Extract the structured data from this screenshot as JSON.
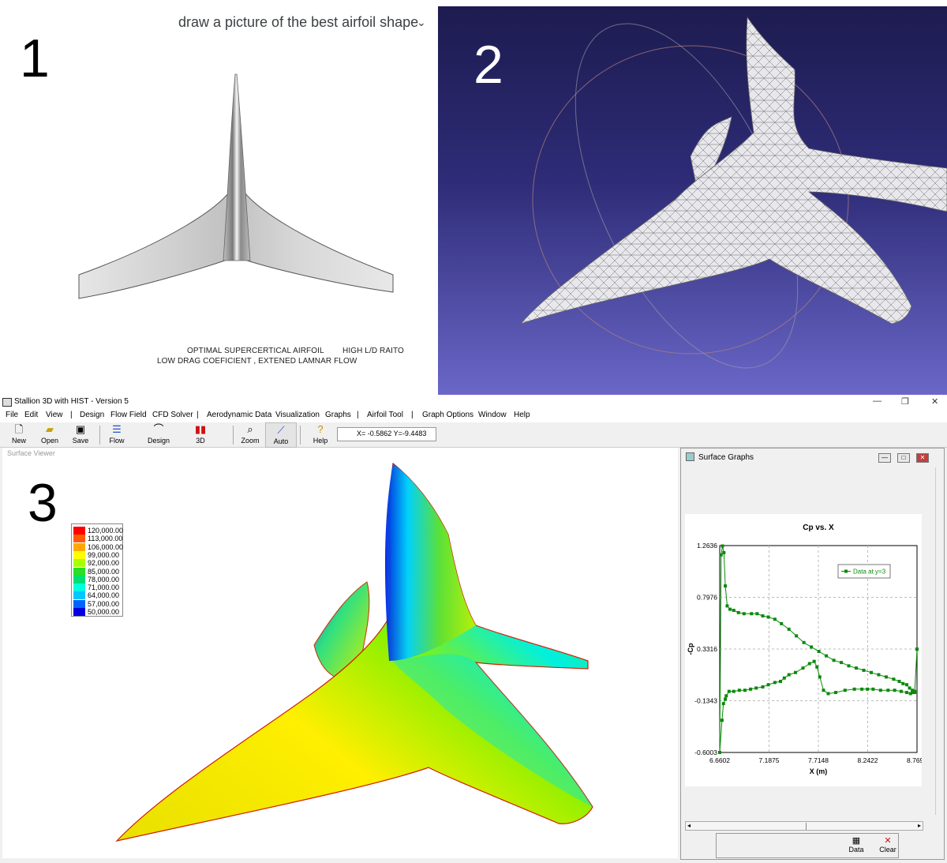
{
  "panel1": {
    "number": "1",
    "prompt": "draw a picture of the best airfoil shape",
    "caption_line1": "OPTIMAL SUPERCERTICAL AIRFOIL",
    "caption_line2": "LOW DRAG COEFICIENT , EXTENED LAMNAR FLOW",
    "caption_right": "HIGH L/D RAITO"
  },
  "panel2": {
    "number": "2"
  },
  "panel3": {
    "number": "3"
  },
  "app": {
    "title": "Stallion 3D with HIST - Version 5",
    "window_controls": [
      "—",
      "❐",
      "✕"
    ],
    "menu": [
      "File",
      "Edit",
      "View",
      "|",
      "Design",
      "Flow Field",
      "CFD Solver",
      "|",
      "Aerodynamic Data",
      "Visualization",
      "Graphs",
      "|",
      "Airfoil Tool",
      "|",
      "Graph Options",
      "Window",
      "Help"
    ],
    "toolbar": {
      "new": "New",
      "open": "Open",
      "save": "Save",
      "flow": "Flow",
      "design": "Design",
      "three_d": "3D",
      "zoom": "Zoom",
      "auto": "Auto",
      "help": "Help",
      "coords": "X= -0.5862  Y=-9.4483"
    },
    "surface_viewer_title": "Surface Viewer",
    "legend": [
      {
        "label": "120,000.00",
        "color": "#ff0000"
      },
      {
        "label": "113,000.00",
        "color": "#ff5a00"
      },
      {
        "label": "106,000.00",
        "color": "#ffa800"
      },
      {
        "label": "99,000.00",
        "color": "#ffff00"
      },
      {
        "label": "92,000.00",
        "color": "#a8ff00"
      },
      {
        "label": "85,000.00",
        "color": "#28e028"
      },
      {
        "label": "78,000.00",
        "color": "#00e070"
      },
      {
        "label": "71,000.00",
        "color": "#00ffe0"
      },
      {
        "label": "64,000.00",
        "color": "#00c8ff"
      },
      {
        "label": "57,000.00",
        "color": "#0064ff"
      },
      {
        "label": "50,000.00",
        "color": "#0000e0"
      }
    ],
    "graphs_title": "Surface Graphs",
    "graph_window_buttons": [
      "—",
      "□",
      "✕"
    ],
    "footer": {
      "data": "Data",
      "clear": "Clear"
    }
  },
  "chart_data": {
    "type": "line",
    "title": "Cp vs. X",
    "xlabel": "X (m)",
    "ylabel": "-Cp",
    "xlim": [
      6.6602,
      8.7695
    ],
    "ylim": [
      -0.6003,
      1.2636
    ],
    "xticks": [
      "6.6602",
      "7.1875",
      "7.7148",
      "8.2422",
      "8.7695"
    ],
    "yticks": [
      "1.2636",
      "0.7976",
      "0.3316",
      "-0.1343",
      "-0.6003"
    ],
    "legend_position": "top-right",
    "grid": true,
    "series": [
      {
        "name": "Data at y=3",
        "color": "#0a8a0a",
        "x": [
          8.7695,
          8.745,
          8.72,
          8.7,
          8.66,
          8.6,
          8.53,
          8.46,
          8.38,
          8.3,
          8.24,
          8.18,
          8.1,
          8.0,
          7.9,
          7.82,
          7.77,
          7.73,
          7.7,
          7.67,
          7.62,
          7.55,
          7.47,
          7.4,
          7.35,
          7.31,
          7.25,
          7.18,
          7.12,
          7.05,
          6.99,
          6.93,
          6.87,
          6.81,
          6.76,
          6.73,
          6.72,
          6.7,
          6.685,
          6.6602,
          6.675,
          6.69,
          6.705,
          6.72,
          6.74,
          6.77,
          6.81,
          6.86,
          6.92,
          7.0,
          7.06,
          7.12,
          7.18,
          7.25,
          7.32,
          7.4,
          7.48,
          7.56,
          7.64,
          7.72,
          7.8,
          7.88,
          7.96,
          8.04,
          8.12,
          8.2,
          8.28,
          8.36,
          8.44,
          8.52,
          8.58,
          8.62,
          8.66,
          8.69,
          8.72,
          8.745,
          8.7695
        ],
        "y": [
          0.33,
          -0.05,
          -0.06,
          -0.07,
          -0.06,
          -0.05,
          -0.04,
          -0.04,
          -0.04,
          -0.03,
          -0.03,
          -0.03,
          -0.03,
          -0.04,
          -0.06,
          -0.07,
          -0.04,
          0.08,
          0.17,
          0.22,
          0.2,
          0.16,
          0.12,
          0.1,
          0.07,
          0.04,
          0.03,
          0.01,
          -0.01,
          -0.02,
          -0.03,
          -0.04,
          -0.04,
          -0.05,
          -0.05,
          -0.09,
          -0.12,
          -0.16,
          -0.31,
          -0.6003,
          1.18,
          1.26,
          1.2,
          0.9,
          0.72,
          0.69,
          0.68,
          0.66,
          0.65,
          0.65,
          0.65,
          0.63,
          0.62,
          0.6,
          0.56,
          0.51,
          0.45,
          0.39,
          0.35,
          0.31,
          0.27,
          0.23,
          0.21,
          0.18,
          0.16,
          0.14,
          0.12,
          0.1,
          0.08,
          0.06,
          0.04,
          0.02,
          0.01,
          -0.02,
          -0.04,
          -0.06,
          0.33
        ]
      }
    ]
  }
}
